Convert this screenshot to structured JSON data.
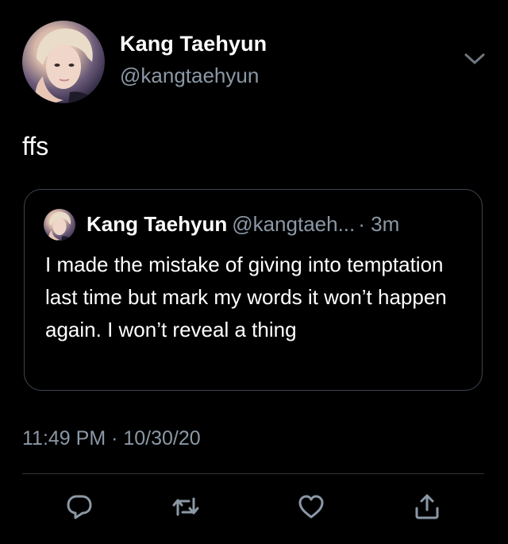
{
  "author": {
    "name": "Kang Taehyun",
    "handle": "@kangtaehyun"
  },
  "tweet": {
    "text": "ffs",
    "timestamp": "11:49 PM · 10/30/20"
  },
  "quoted_tweet": {
    "name": "Kang Taehyun",
    "handle": "@kangtaeh...",
    "time": "· 3m",
    "text": "I made the mistake of giving into temptation last time but mark my words it won’t happen again. I won’t reveal a thing"
  },
  "icons": {
    "menu": "chevron-down-icon",
    "reply": "reply-icon",
    "retweet": "retweet-icon",
    "like": "heart-icon",
    "share": "share-icon"
  },
  "colors": {
    "background": "#000000",
    "primary_text": "#ffffff",
    "secondary_text": "#8b98a5",
    "border": "#3d4550",
    "icon": "#8b98a5"
  }
}
